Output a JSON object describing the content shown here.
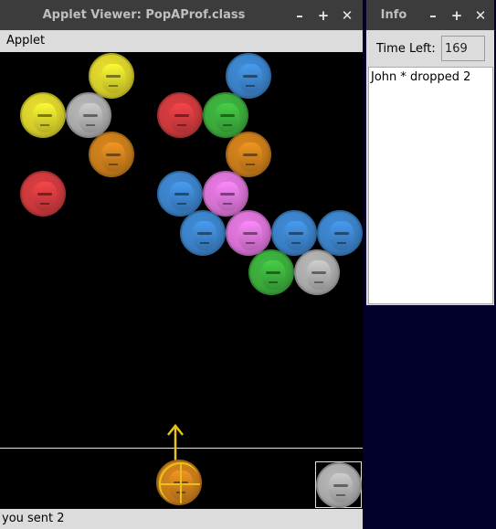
{
  "applet_window": {
    "title": "Applet Viewer: PopAProf.class",
    "minimize": "–",
    "maximize": "+",
    "close": "✕",
    "menu_label": "Applet",
    "status": "you sent 2"
  },
  "info_window": {
    "title": "Info",
    "minimize": "–",
    "maximize": "+",
    "close": "✕",
    "time_label": "Time Left:",
    "time_value": "169",
    "log_lines": [
      "John * dropped 2"
    ]
  },
  "colors": {
    "yellow": "#d4cc2a",
    "gray": "#a8a8a8",
    "orange": "#c47a1a",
    "red": "#c8383c",
    "blue": "#3a7fc4",
    "green": "#3aa83a",
    "pink": "#d470d0",
    "arrow": "#e8c21c"
  },
  "grid": [
    {
      "row": 0,
      "col": 1,
      "color": "yellow"
    },
    {
      "row": 0,
      "col": 4,
      "color": "blue"
    },
    {
      "row": 1,
      "col": 0,
      "color": "yellow"
    },
    {
      "row": 1,
      "col": 1,
      "color": "gray"
    },
    {
      "row": 1,
      "col": 3,
      "color": "red"
    },
    {
      "row": 1,
      "col": 4,
      "color": "green"
    },
    {
      "row": 2,
      "col": 1,
      "color": "orange"
    },
    {
      "row": 2,
      "col": 4,
      "color": "orange"
    },
    {
      "row": 3,
      "col": 0,
      "color": "red"
    },
    {
      "row": 3,
      "col": 3,
      "color": "blue"
    },
    {
      "row": 3,
      "col": 4,
      "color": "pink"
    },
    {
      "row": 4,
      "col": 3,
      "color": "blue"
    },
    {
      "row": 4,
      "col": 4,
      "color": "pink"
    },
    {
      "row": 4,
      "col": 5,
      "color": "blue"
    },
    {
      "row": 4,
      "col": 6,
      "color": "blue"
    },
    {
      "row": 5,
      "col": 5,
      "color": "green"
    },
    {
      "row": 5,
      "col": 6,
      "color": "gray"
    }
  ],
  "shooter": {
    "color": "orange"
  },
  "next_bubble": {
    "color": "gray"
  }
}
